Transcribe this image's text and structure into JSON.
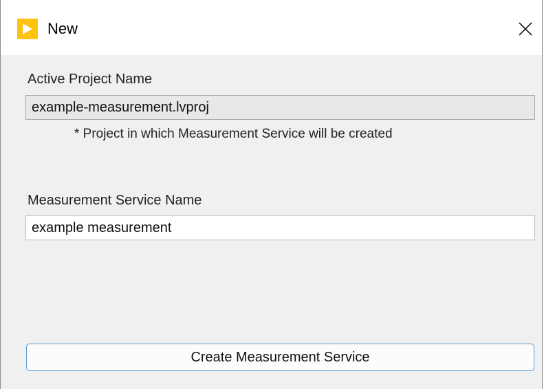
{
  "window": {
    "title": "New",
    "app_icon": "labview-play-icon",
    "close_icon": "close-icon"
  },
  "form": {
    "active_project_label": "Active Project Name",
    "active_project_value": "example-measurement.lvproj",
    "active_project_note": "* Project in which Measurement Service will be created",
    "service_name_label": "Measurement Service Name",
    "service_name_value": "example measurement"
  },
  "actions": {
    "create_label": "Create Measurement Service"
  },
  "colors": {
    "icon_accent": "#ffc20e",
    "button_border": "#5b9bd5",
    "dialog_background": "#f0f0f0"
  }
}
